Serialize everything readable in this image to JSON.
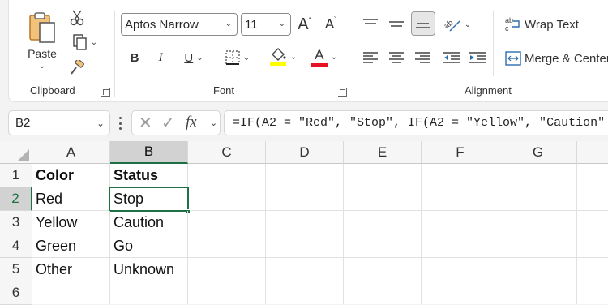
{
  "ribbon": {
    "clipboard": {
      "paste_label": "Paste",
      "group_label": "Clipboard"
    },
    "font": {
      "font_name": "Aptos Narrow",
      "font_size": "11",
      "grow_label": "A",
      "shrink_label": "A",
      "bold_label": "B",
      "italic_label": "I",
      "underline_label": "U",
      "font_color_label": "A",
      "highlight_color": "#ffff00",
      "font_color": "#e81123",
      "group_label": "Font"
    },
    "alignment": {
      "wrap_text_label": "Wrap Text",
      "merge_center_label": "Merge & Center",
      "group_label": "Alignment"
    }
  },
  "formula_bar": {
    "name_box": "B2",
    "fx_label": "fx",
    "formula": "=IF(A2 = \"Red\", \"Stop\", IF(A2 = \"Yellow\", \"Caution\""
  },
  "sheet": {
    "columns": [
      "A",
      "B",
      "C",
      "D",
      "E",
      "F",
      "G"
    ],
    "rows": [
      "1",
      "2",
      "3",
      "4",
      "5",
      "6"
    ],
    "cells": {
      "A1": "Color",
      "B1": "Status",
      "A2": "Red",
      "B2": "Stop",
      "A3": "Yellow",
      "B3": "Caution",
      "A4": "Green",
      "B4": "Go",
      "A5": "Other",
      "B5": "Unknown"
    },
    "accent": "#1e7145"
  }
}
